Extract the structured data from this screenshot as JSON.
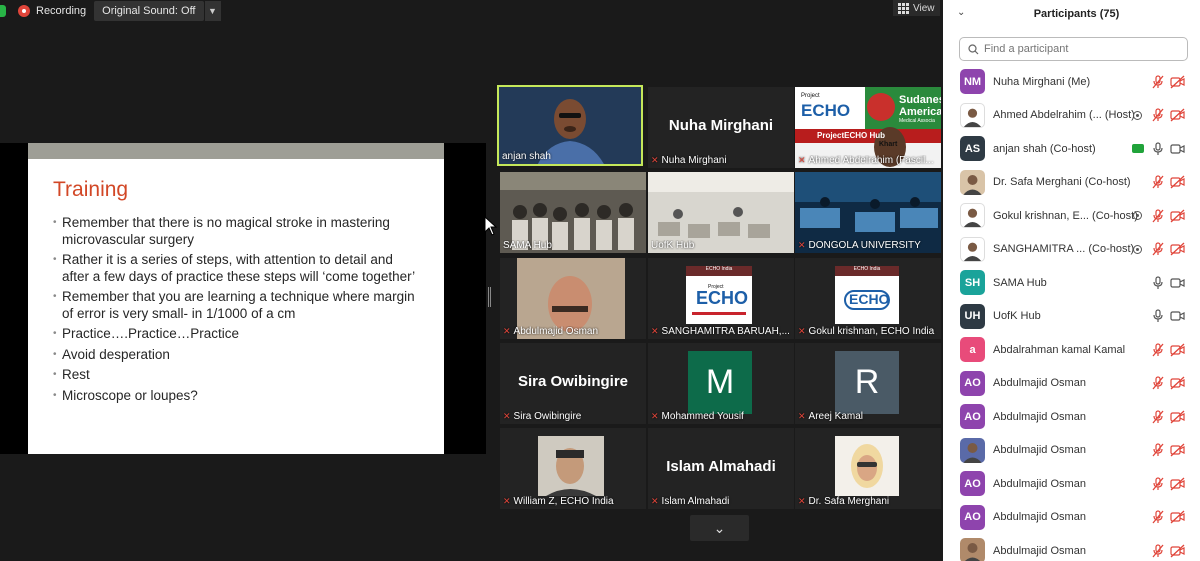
{
  "toolbar": {
    "recording_label": "Recording",
    "sound_label": "Original Sound: Off",
    "view_label": "View"
  },
  "slide": {
    "title": "Training",
    "bullets": [
      "Remember that there is no magical stroke in mastering microvascular surgery",
      "Rather it is a series of steps, with attention to detail and after a few days of practice these steps will            ‘come together’",
      "Remember that you are learning a technique where margin of error is very small- in 1/1000 of a cm",
      "Practice….Practice…Practice",
      "Avoid desperation",
      "Rest",
      "Microscope or loupes?"
    ]
  },
  "tiles": [
    {
      "name": "anjan shah",
      "big": "",
      "muted": false
    },
    {
      "name": "Nuha Mirghani",
      "big": "Nuha Mirghani",
      "muted": true
    },
    {
      "name": "Ahmed Abdelrahim (Fascil...",
      "big": "",
      "muted": true
    },
    {
      "name": "SAMA Hub",
      "big": "",
      "muted": false
    },
    {
      "name": "UofK Hub",
      "big": "",
      "muted": false
    },
    {
      "name": "DONGOLA UNIVERSITY",
      "big": "",
      "muted": true
    },
    {
      "name": "Abdulmajid Osman",
      "big": "",
      "muted": true
    },
    {
      "name": "SANGHAMITRA BARUAH,...",
      "big": "",
      "muted": true
    },
    {
      "name": "Gokul krishnan, ECHO India",
      "big": "",
      "muted": true
    },
    {
      "name": "Sira Owibingire",
      "big": "Sira Owibingire",
      "muted": true
    },
    {
      "name": "Mohammed Yousif",
      "big": "",
      "muted": true,
      "letter": "M"
    },
    {
      "name": "Areej Kamal",
      "big": "",
      "muted": true,
      "letter": "R"
    },
    {
      "name": "William Z, ECHO India",
      "big": "",
      "muted": true
    },
    {
      "name": "Islam Almahadi",
      "big": "Islam Almahadi",
      "muted": true
    },
    {
      "name": "Dr. Safa Merghani",
      "big": "",
      "muted": true
    }
  ],
  "echo_logo": {
    "brand": "ECHO",
    "project": "Project",
    "india": "ECHO India",
    "sudanese": "Sudanes",
    "america": "America",
    "medical": "Medical Associa",
    "hub": "ProjectECHO Hub",
    "khartoum": "Khart"
  },
  "panel": {
    "title": "Participants (75)",
    "search_placeholder": "Find a participant",
    "participants": [
      {
        "initials": "NM",
        "name": "Nuha Mirghani (Me)",
        "color": "#8e44ad"
      },
      {
        "initials": "",
        "name": "Ahmed Abdelrahim (... (Host)",
        "color": "#ffffff"
      },
      {
        "initials": "AS",
        "name": "anjan shah (Co-host)",
        "color": "#2e3a44"
      },
      {
        "initials": "",
        "name": "Dr. Safa Merghani (Co-host)",
        "color": "#d9c4a8"
      },
      {
        "initials": "",
        "name": "Gokul krishnan, E... (Co-host)",
        "color": "#ffffff"
      },
      {
        "initials": "",
        "name": "SANGHAMITRA ...  (Co-host)",
        "color": "#ffffff"
      },
      {
        "initials": "SH",
        "name": "SAMA Hub",
        "color": "#1aa39a"
      },
      {
        "initials": "UH",
        "name": "UofK Hub",
        "color": "#2e3a44"
      },
      {
        "initials": "a",
        "name": "Abdalrahman kamal Kamal",
        "color": "#e84b7a"
      },
      {
        "initials": "AO",
        "name": "Abdulmajid Osman",
        "color": "#8e44ad"
      },
      {
        "initials": "AO",
        "name": "Abdulmajid Osman",
        "color": "#8e44ad"
      },
      {
        "initials": "",
        "name": "Abdulmajid Osman",
        "color": "#5a6aa8"
      },
      {
        "initials": "AO",
        "name": "Abdulmajid Osman",
        "color": "#8e44ad"
      },
      {
        "initials": "AO",
        "name": "Abdulmajid Osman",
        "color": "#8e44ad"
      },
      {
        "initials": "",
        "name": "Abdulmajid Osman",
        "color": "#b08a6a"
      }
    ]
  }
}
